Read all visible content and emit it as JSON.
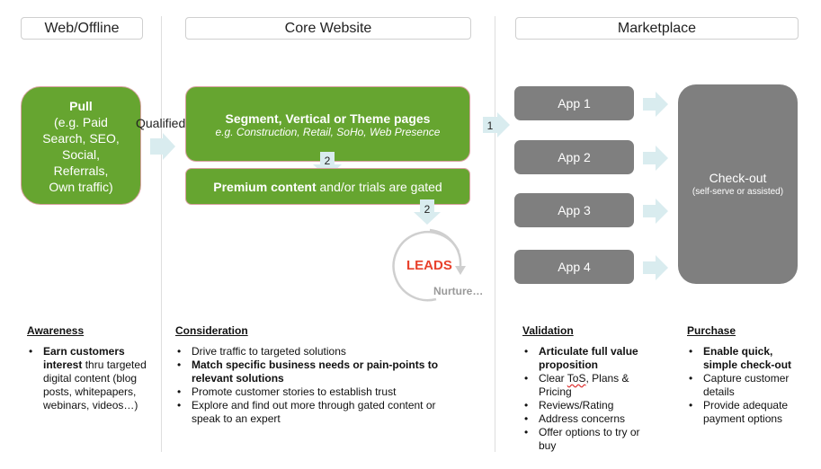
{
  "headers": {
    "web_offline": "Web/Offline",
    "core_website": "Core Website",
    "marketplace": "Marketplace"
  },
  "pull_box": {
    "title": "Pull",
    "lines": [
      "(e.g. Paid",
      "Search, SEO,",
      "Social,",
      "Referrals,",
      "Own traffic)"
    ]
  },
  "qualified_label": "Qualified",
  "segment_box": {
    "title": "Segment, Vertical or Theme pages",
    "subtitle": "e.g. Construction, Retail, SoHo, Web Presence"
  },
  "premium_box": {
    "bold": "Premium content",
    "rest": " and/or trials are gated"
  },
  "step_labels": {
    "to_marketplace": "1",
    "to_premium": "2",
    "to_leads": "2"
  },
  "leads": {
    "label": "LEADS",
    "nurture": "Nurture…"
  },
  "apps": [
    "App 1",
    "App 2",
    "App 3",
    "App 4"
  ],
  "checkout": {
    "title": "Check-out",
    "subtitle": "(self-serve or assisted)"
  },
  "colors": {
    "green": "#66a530",
    "gray": "#7f7f7f",
    "arrow": "#d9ecef",
    "leads_red": "#e8412c"
  },
  "stages": {
    "awareness": {
      "heading": "Awareness",
      "bullets": [
        {
          "bold": "Earn customers interest",
          "rest": " thru targeted digital content (blog posts, whitepapers, webinars, videos…)"
        }
      ]
    },
    "consideration": {
      "heading": "Consideration",
      "bullets": [
        {
          "bold": "",
          "rest": "Drive traffic to targeted solutions"
        },
        {
          "bold": "Match specific business needs or pain-points to relevant solutions",
          "rest": ""
        },
        {
          "bold": "",
          "rest": "Promote customer stories to establish trust"
        },
        {
          "bold": "",
          "rest": "Explore and find out more through gated content or speak to an expert"
        }
      ]
    },
    "validation": {
      "heading": "Validation",
      "bullets": [
        {
          "bold": "Articulate full value proposition",
          "rest": ""
        },
        {
          "pre": "Clear ",
          "wavy": "ToS",
          "rest": ", Plans & Pricing"
        },
        {
          "bold": "",
          "rest": "Reviews/Rating"
        },
        {
          "bold": "",
          "rest": "Address concerns"
        },
        {
          "bold": "",
          "rest": "Offer options to try or buy"
        }
      ]
    },
    "purchase": {
      "heading": "Purchase",
      "bullets": [
        {
          "bold": "Enable quick, simple  check-out",
          "rest": ""
        },
        {
          "bold": "",
          "rest": "Capture customer details"
        },
        {
          "bold": "",
          "rest": "Provide adequate payment options"
        }
      ]
    }
  }
}
